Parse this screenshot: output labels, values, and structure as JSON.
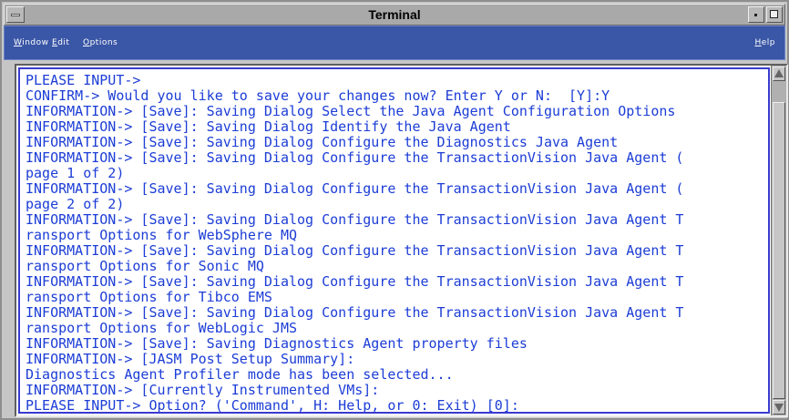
{
  "window": {
    "title": "Terminal"
  },
  "menubar": {
    "items": [
      {
        "label": "Window",
        "mnemonic_index": 0
      },
      {
        "label": "Edit",
        "mnemonic_index": 0
      },
      {
        "label": "Options",
        "mnemonic_index": 0
      }
    ],
    "help": "Help"
  },
  "terminal": {
    "lines": [
      "PLEASE INPUT->",
      "CONFIRM-> Would you like to save your changes now? Enter Y or N:  [Y]:Y",
      "INFORMATION-> [Save]: Saving Dialog Select the Java Agent Configuration Options",
      "INFORMATION-> [Save]: Saving Dialog Identify the Java Agent",
      "INFORMATION-> [Save]: Saving Dialog Configure the Diagnostics Java Agent",
      "INFORMATION-> [Save]: Saving Dialog Configure the TransactionVision Java Agent (",
      "page 1 of 2)",
      "INFORMATION-> [Save]: Saving Dialog Configure the TransactionVision Java Agent (",
      "page 2 of 2)",
      "INFORMATION-> [Save]: Saving Dialog Configure the TransactionVision Java Agent T",
      "ransport Options for WebSphere MQ",
      "INFORMATION-> [Save]: Saving Dialog Configure the TransactionVision Java Agent T",
      "ransport Options for Sonic MQ",
      "INFORMATION-> [Save]: Saving Dialog Configure the TransactionVision Java Agent T",
      "ransport Options for Tibco EMS",
      "INFORMATION-> [Save]: Saving Dialog Configure the TransactionVision Java Agent T",
      "ransport Options for WebLogic JMS",
      "INFORMATION-> [Save]: Saving Diagnostics Agent property files",
      "INFORMATION-> [JASM Post Setup Summary]:",
      "Diagnostics Agent Profiler mode has been selected...",
      "INFORMATION-> [Currently Instrumented VMs]:",
      "PLEASE INPUT-> Option? ('Command', H: Help, or 0: Exit) [0]:"
    ]
  },
  "scrollbar": {
    "position_fraction": 0.97
  },
  "colors": {
    "text": "#1c3dd6",
    "menubar": "#3a56a6",
    "background": "#ffffff"
  }
}
